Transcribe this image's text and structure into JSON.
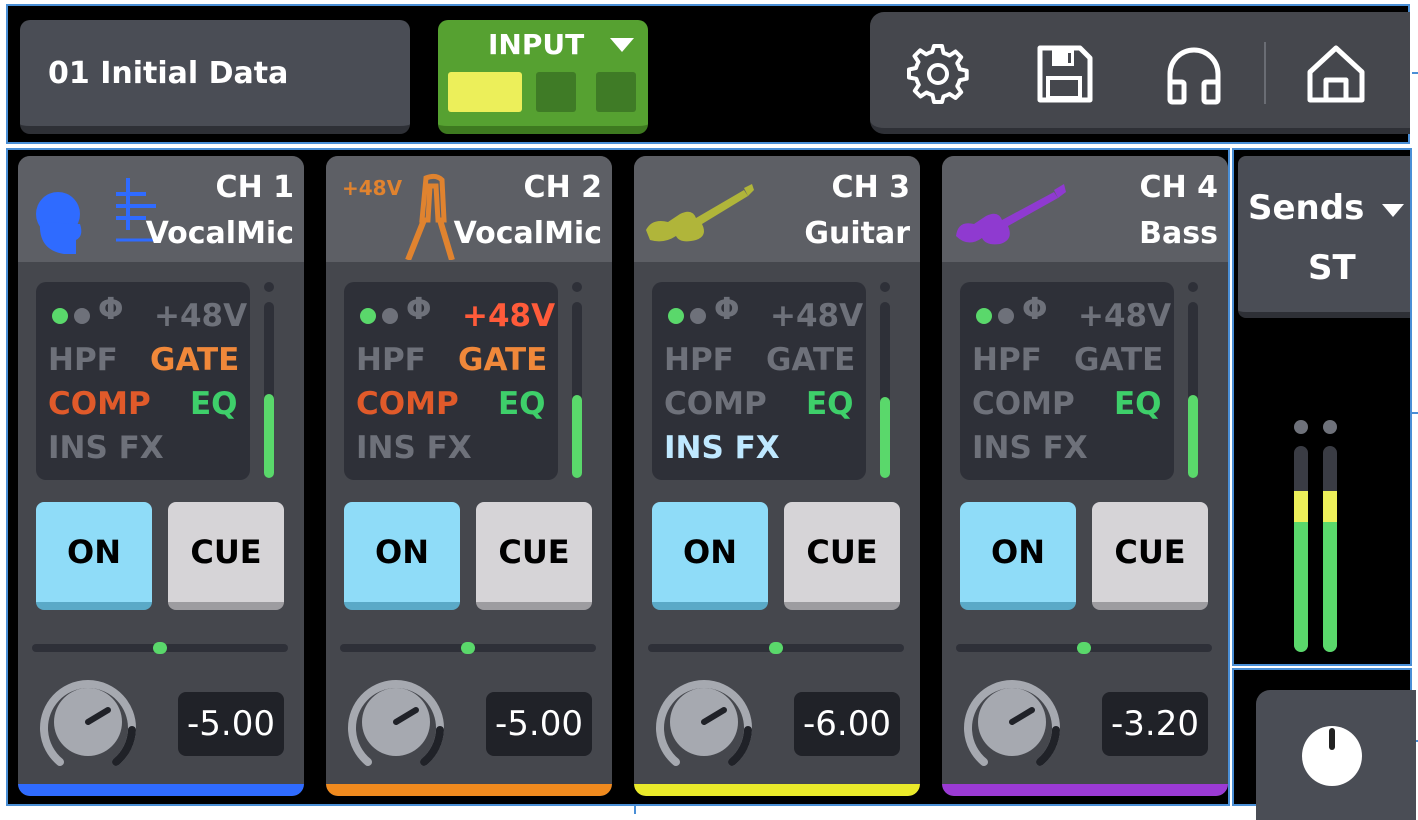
{
  "header": {
    "scene_label": "01  Initial Data",
    "layer_button_label": "INPUT",
    "layers": [
      {
        "name": "layer-1",
        "active": true
      },
      {
        "name": "layer-2",
        "active": false
      },
      {
        "name": "layer-3",
        "active": false
      }
    ],
    "toolbar_icons": [
      "gear-icon",
      "save-icon",
      "headphones-icon",
      "home-icon"
    ]
  },
  "processing_labels": {
    "phantom": "+48V",
    "phase": "Φ",
    "hpf": "HPF",
    "gate": "GATE",
    "comp": "COMP",
    "eq": "EQ",
    "ins_fx": "INS FX"
  },
  "channels": [
    {
      "number": "CH 1",
      "name": "VocalMic",
      "icon": "vocal-mic-icon",
      "phantom_on": false,
      "hpf_on": false,
      "gate_on": true,
      "comp_on": true,
      "eq_on": true,
      "insfx_on": false,
      "on_label": "ON",
      "cue_label": "CUE",
      "level": "-5.00",
      "meter_fraction": 0.48,
      "pan": 0.5,
      "color": "#2f6bff"
    },
    {
      "number": "CH 2",
      "name": "VocalMic",
      "icon": "condenser-mic-icon",
      "phantom_badge": "+48V",
      "phantom_on": true,
      "hpf_on": false,
      "gate_on": true,
      "comp_on": true,
      "eq_on": true,
      "insfx_on": false,
      "on_label": "ON",
      "cue_label": "CUE",
      "level": "-5.00",
      "meter_fraction": 0.47,
      "pan": 0.5,
      "color": "#f08a1e"
    },
    {
      "number": "CH 3",
      "name": "Guitar",
      "icon": "electric-guitar-icon",
      "phantom_on": false,
      "hpf_on": false,
      "gate_on": false,
      "comp_on": false,
      "eq_on": true,
      "insfx_on": true,
      "on_label": "ON",
      "cue_label": "CUE",
      "level": "-6.00",
      "meter_fraction": 0.46,
      "pan": 0.5,
      "color": "#eaea2a"
    },
    {
      "number": "CH 4",
      "name": "Bass",
      "icon": "bass-guitar-icon",
      "phantom_on": false,
      "hpf_on": false,
      "gate_on": false,
      "comp_on": false,
      "eq_on": true,
      "insfx_on": false,
      "on_label": "ON",
      "cue_label": "CUE",
      "level": "-3.20",
      "meter_fraction": 0.47,
      "pan": 0.5,
      "color": "#9b3ad4"
    }
  ],
  "sends": {
    "label": "Sends",
    "sub_label": "ST",
    "meter_left": {
      "green": 0.63,
      "yellow": 0.15
    },
    "meter_right": {
      "green": 0.63,
      "yellow": 0.15
    }
  },
  "colors": {
    "on_active": "#8fdcf8",
    "cue": "#d6d4d7",
    "gate_active": "#f0883a",
    "comp_active": "#e05a2a",
    "eq_active": "#3ecf6a",
    "insfx_active": "#bfe8ff",
    "phantom_active": "#ff5b3a",
    "inactive_text": "#6e717a",
    "meter_green": "#5ad86b",
    "accent_green": "#56a131"
  }
}
